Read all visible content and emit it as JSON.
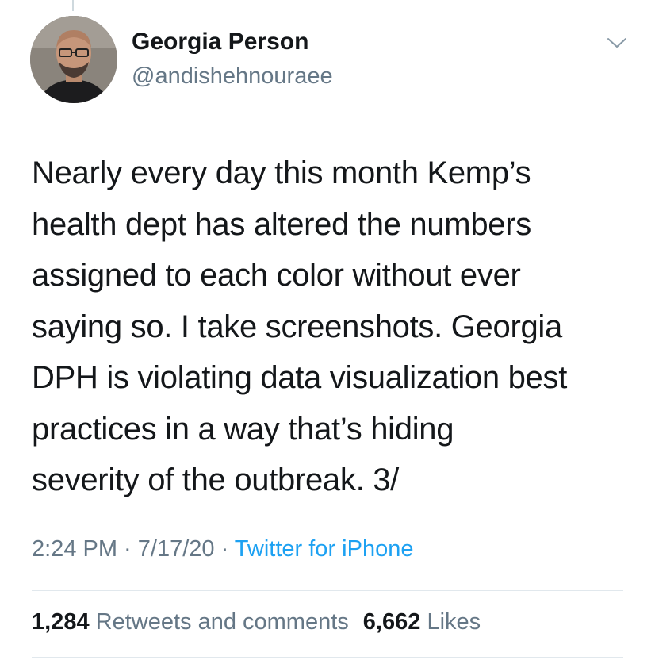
{
  "tweet": {
    "author": {
      "display_name": "Georgia Person",
      "handle": "@andishehnouraee"
    },
    "text": "Nearly every day this month Kemp’s\nhealth dept has altered the numbers\nassigned to each color without ever\nsaying so. I take screenshots. Georgia\nDPH is violating data visualization best\npractices in a way that’s hiding\nseverity of the outbreak. 3/",
    "time": "2:24 PM",
    "separator": " · ",
    "date": "7/17/20",
    "source": "Twitter for iPhone",
    "retweets_count": "1,284",
    "retweets_label": "Retweets and comments",
    "likes_count": "6,662",
    "likes_label": "Likes"
  },
  "colors": {
    "text_primary": "#14171a",
    "text_secondary": "#657786",
    "link": "#1da1f2",
    "divider": "#e1e8ed"
  },
  "icons": {
    "menu": "chevron-down-icon"
  }
}
